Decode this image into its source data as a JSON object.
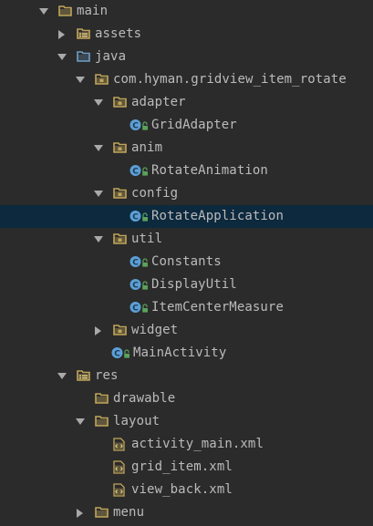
{
  "tree": {
    "items": [
      {
        "id": "main",
        "label": "main",
        "depth": 0,
        "expanded": true,
        "icon": "folder-icon"
      },
      {
        "id": "assets",
        "label": "assets",
        "depth": 1,
        "expanded": false,
        "icon": "resource-folder-icon"
      },
      {
        "id": "java",
        "label": "java",
        "depth": 1,
        "expanded": true,
        "icon": "source-folder-icon"
      },
      {
        "id": "package-root",
        "label": "com.hyman.gridview_item_rotate",
        "depth": 2,
        "expanded": true,
        "icon": "package-icon"
      },
      {
        "id": "adapter",
        "label": "adapter",
        "depth": 3,
        "expanded": true,
        "icon": "package-icon"
      },
      {
        "id": "GridAdapter",
        "label": "GridAdapter",
        "depth": 4,
        "icon": "class-icon"
      },
      {
        "id": "anim",
        "label": "anim",
        "depth": 3,
        "expanded": true,
        "icon": "package-icon"
      },
      {
        "id": "RotateAnimation",
        "label": "RotateAnimation",
        "depth": 4,
        "icon": "class-icon"
      },
      {
        "id": "config",
        "label": "config",
        "depth": 3,
        "expanded": true,
        "icon": "package-icon"
      },
      {
        "id": "RotateApplication",
        "label": "RotateApplication",
        "depth": 4,
        "icon": "class-icon",
        "selected": true
      },
      {
        "id": "util",
        "label": "util",
        "depth": 3,
        "expanded": true,
        "icon": "package-icon"
      },
      {
        "id": "Constants",
        "label": "Constants",
        "depth": 4,
        "icon": "class-icon"
      },
      {
        "id": "DisplayUtil",
        "label": "DisplayUtil",
        "depth": 4,
        "icon": "class-icon"
      },
      {
        "id": "ItemCenterMeasure",
        "label": "ItemCenterMeasure",
        "depth": 4,
        "icon": "class-icon"
      },
      {
        "id": "widget",
        "label": "widget",
        "depth": 3,
        "expanded": false,
        "icon": "package-icon"
      },
      {
        "id": "MainActivity",
        "label": "MainActivity",
        "depth": 3,
        "icon": "class-icon"
      },
      {
        "id": "res",
        "label": "res",
        "depth": 1,
        "expanded": true,
        "icon": "resource-folder-icon"
      },
      {
        "id": "drawable",
        "label": "drawable",
        "depth": 2,
        "icon": "folder-icon"
      },
      {
        "id": "layout",
        "label": "layout",
        "depth": 2,
        "expanded": true,
        "icon": "folder-icon"
      },
      {
        "id": "activity_main",
        "label": "activity_main.xml",
        "depth": 3,
        "icon": "xml-file-icon"
      },
      {
        "id": "grid_item",
        "label": "grid_item.xml",
        "depth": 3,
        "icon": "xml-file-icon"
      },
      {
        "id": "view_back",
        "label": "view_back.xml",
        "depth": 3,
        "icon": "xml-file-icon"
      },
      {
        "id": "menu",
        "label": "menu",
        "depth": 2,
        "expanded": false,
        "icon": "folder-icon"
      }
    ]
  },
  "colors": {
    "background": "#2b2b2b",
    "text": "#bbbbbb",
    "selection": "#0d293e",
    "folder": "#c0a55a",
    "source_folder": "#6e9fc8",
    "class_circle": "#5c9fd6",
    "lock_green": "#5aa35a"
  }
}
